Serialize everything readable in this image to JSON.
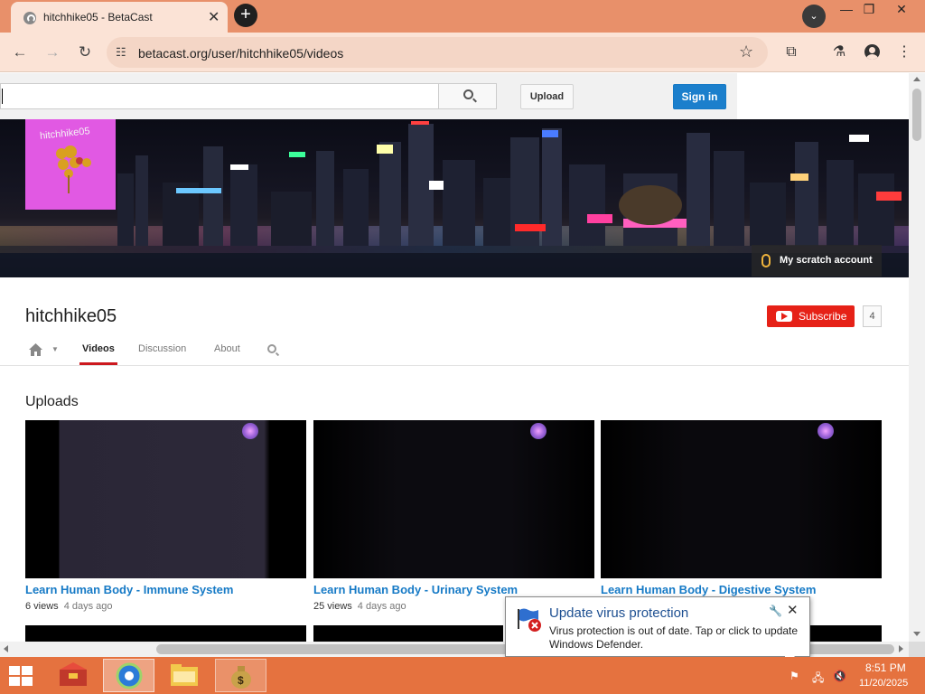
{
  "browser": {
    "tab_title": "hitchhike05 - BetaCast",
    "url": "betacast.org/user/hitchhike05/videos"
  },
  "masthead": {
    "search_placeholder": "",
    "upload_label": "Upload",
    "signin_label": "Sign in"
  },
  "channel": {
    "avatar_text": "hitchhike05",
    "scratch_link": "My scratch account",
    "name": "hitchhike05",
    "subscribe_label": "Subscribe",
    "subscriber_count": "4",
    "tabs": {
      "videos": "Videos",
      "discussion": "Discussion",
      "about": "About"
    },
    "uploads_heading": "Uploads"
  },
  "videos": [
    {
      "title": "Learn Human Body - Immune System",
      "views": "6 views",
      "age": "4 days ago"
    },
    {
      "title": "Learn Human Body - Urinary System",
      "views": "25 views",
      "age": "4 days ago"
    },
    {
      "title": "Learn Human Body - Digestive System",
      "views": "",
      "age": ""
    }
  ],
  "notification": {
    "title": "Update virus protection",
    "body": "Virus protection is out of date. Tap or click to update Windows Defender."
  },
  "taskbar": {
    "time": "8:51 PM",
    "date": "11/20/2025"
  },
  "colors": {
    "accent_link": "#167ac6",
    "subscribe_red": "#e62117",
    "signin_blue": "#1b7fcc",
    "taskbar_orange": "#e5723f",
    "titlebar_orange": "#e8906a"
  }
}
